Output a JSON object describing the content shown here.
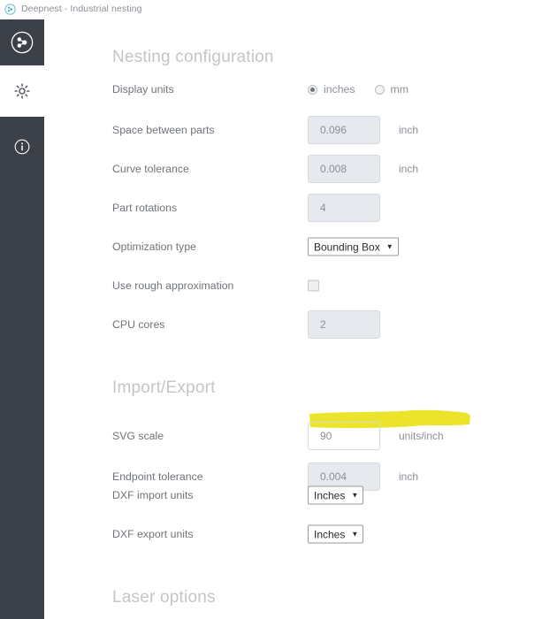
{
  "window": {
    "title": "Deepnest - Industrial nesting",
    "icon": "deepnest-logo-icon"
  },
  "sidebar": {
    "items": [
      {
        "name": "nest-view",
        "icon": "deepnest-logo-icon",
        "active": false
      },
      {
        "name": "settings-view",
        "icon": "gear-icon",
        "active": true
      },
      {
        "name": "info-view",
        "icon": "info-icon",
        "active": false
      }
    ]
  },
  "sections": {
    "nesting": {
      "title": "Nesting configuration",
      "rows": {
        "display_units": {
          "label": "Display units",
          "options": [
            {
              "label": "inches",
              "selected": true
            },
            {
              "label": "mm",
              "selected": false
            }
          ]
        },
        "space_between_parts": {
          "label": "Space between parts",
          "value": "0.096",
          "unit": "inch"
        },
        "curve_tolerance": {
          "label": "Curve tolerance",
          "value": "0.008",
          "unit": "inch"
        },
        "part_rotations": {
          "label": "Part rotations",
          "value": "4",
          "unit": ""
        },
        "optimization_type": {
          "label": "Optimization type",
          "value": "Bounding Box",
          "caret": "▼"
        },
        "rough_approximation": {
          "label": "Use rough approximation",
          "checked": false
        },
        "cpu_cores": {
          "label": "CPU cores",
          "value": "2",
          "unit": ""
        }
      }
    },
    "importexport": {
      "title": "Import/Export",
      "rows": {
        "svg_scale": {
          "label": "SVG scale",
          "value": "90",
          "unit": "units/inch",
          "highlighted": true
        },
        "endpoint_tolerance": {
          "label": "Endpoint tolerance",
          "value": "0.004",
          "unit": "inch"
        },
        "dxf_import_units": {
          "label": "DXF import units",
          "value": "Inches",
          "caret": "▼"
        },
        "dxf_export_units": {
          "label": "DXF export units",
          "value": "Inches",
          "caret": "▼"
        }
      }
    },
    "laser": {
      "title": "Laser options"
    }
  },
  "colors": {
    "rail_dark": "#3c4049",
    "heading_gray": "#c3c5c8",
    "label_gray": "#6f7479",
    "field_bg": "#e6eaef",
    "highlight_yellow": "#eae21a",
    "logo_teal": "#4fb3c4"
  }
}
